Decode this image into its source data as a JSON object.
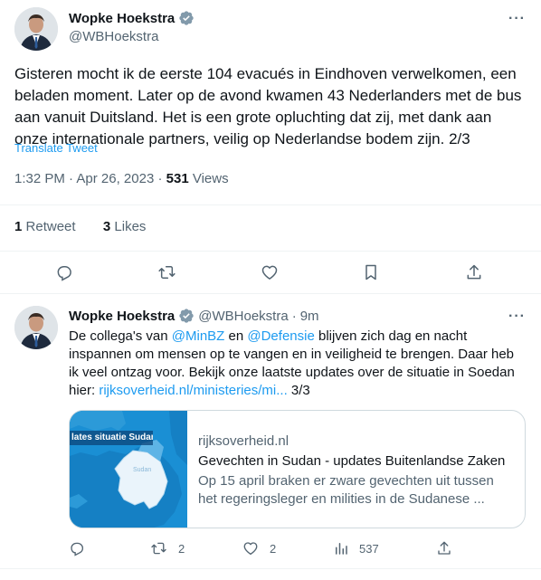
{
  "main_tweet": {
    "name": "Wopke Hoekstra",
    "handle": "@WBHoekstra",
    "text": "Gisteren mocht ik de eerste 104 evacués in Eindhoven verwelkomen, een beladen moment. Later op de avond kwamen 43 Nederlanders met de bus aan vanuit Duitsland. Het is een grote opluchting dat zij, met dank aan onze internationale partners, veilig op Nederlandse bodem zijn. 2/3",
    "translate_label": "Translate Tweet",
    "time": "1:32 PM",
    "date": "Apr 26, 2023",
    "views_count": "531",
    "views_label": "Views",
    "retweets_count": "1",
    "retweets_label": "Retweet",
    "likes_count": "3",
    "likes_label": "Likes"
  },
  "reply_tweet": {
    "name": "Wopke Hoekstra",
    "handle": "@WBHoekstra",
    "time_ago": "9m",
    "text_1": "De collega's van ",
    "mention_1": "@MinBZ",
    "text_2": " en ",
    "mention_2": "@Defensie",
    "text_3": " blijven zich dag en nacht inspannen om mensen op te vangen en in veiligheid te brengen. Daar heb ik veel ontzag voor. Bekijk onze laatste updates over de situatie in Soedan hier: ",
    "url": "rijksoverheid.nl/ministeries/mi...",
    "text_4": " 3/3",
    "card": {
      "image_caption": "lates situatie Sudan",
      "map_label": "Sudan",
      "domain": "rijksoverheid.nl",
      "title": "Gevechten in Sudan - updates Buitenlandse Zaken",
      "description": "Op 15 april braken er zware gevechten uit tussen het regeringsleger en milities in de Sudanese ..."
    },
    "retweets": "2",
    "likes": "2",
    "views": "537"
  },
  "colors": {
    "accent": "#1d9bf0",
    "text": "#0f1419",
    "secondary": "#536471",
    "divider": "#eff3f4"
  }
}
